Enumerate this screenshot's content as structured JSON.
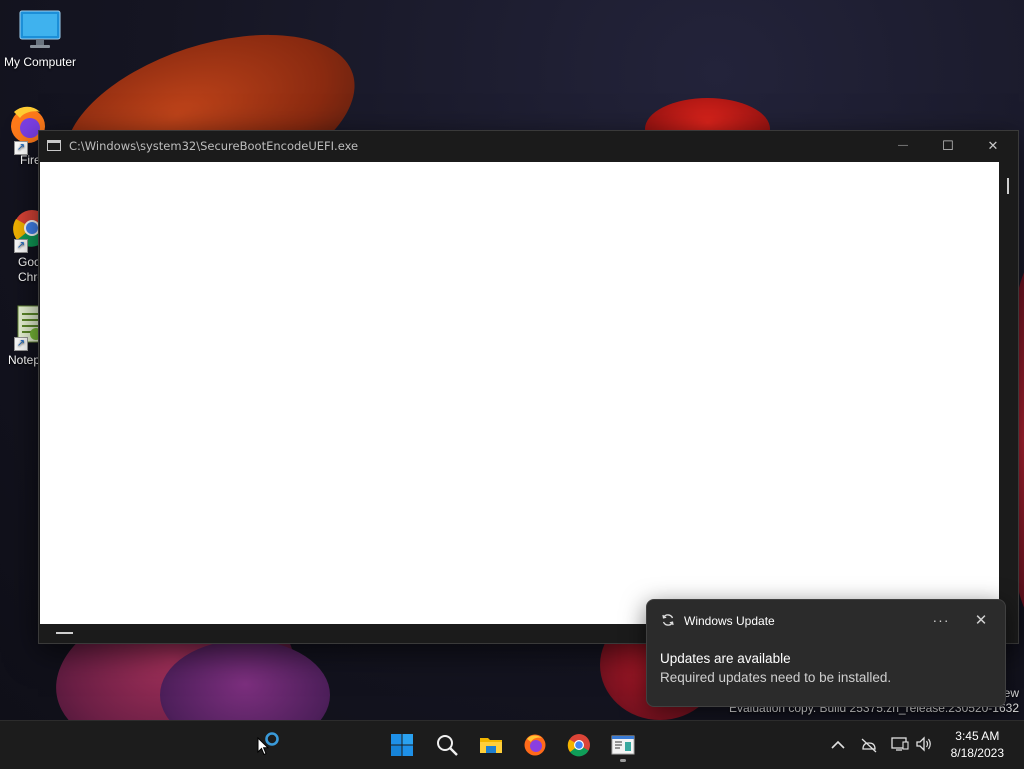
{
  "desktop": {
    "icons": [
      {
        "label": "My Computer",
        "icon": "monitor-icon"
      },
      {
        "label": "Fire",
        "icon": "firefox-icon"
      },
      {
        "label": "Goo\nChro",
        "icon": "chrome-icon"
      },
      {
        "label": "Notep",
        "icon": "notepad-icon"
      }
    ],
    "watermark_line1": "ew",
    "watermark_line2": "Evaluation copy. Build 25375.zn_release.230520-1632"
  },
  "window": {
    "title": "C:\\Windows\\system32\\SecureBootEncodeUEFI.exe",
    "minimize_glyph": "—",
    "maximize_glyph": "☐",
    "close_glyph": "✕"
  },
  "toast": {
    "app_name": "Windows Update",
    "more_glyph": "···",
    "close_glyph": "✕",
    "title": "Updates are available",
    "body": "Required updates need to be installed."
  },
  "taskbar": {
    "pinned": [
      "cortana-icon",
      "start-icon",
      "search-icon",
      "file-explorer-icon",
      "firefox-icon",
      "chrome-icon",
      "console-app-icon"
    ],
    "tray": [
      "chevron-up-icon",
      "network-offline-icon",
      "display-icon",
      "volume-icon"
    ],
    "clock_time": "3:45 AM",
    "clock_date": "8/18/2023"
  },
  "colors": {
    "accent_blue": "#0078d4",
    "window_bg": "#1b1b1b",
    "toast_bg": "#2b2b2b",
    "taskbar_bg": "#1c1c1c"
  }
}
